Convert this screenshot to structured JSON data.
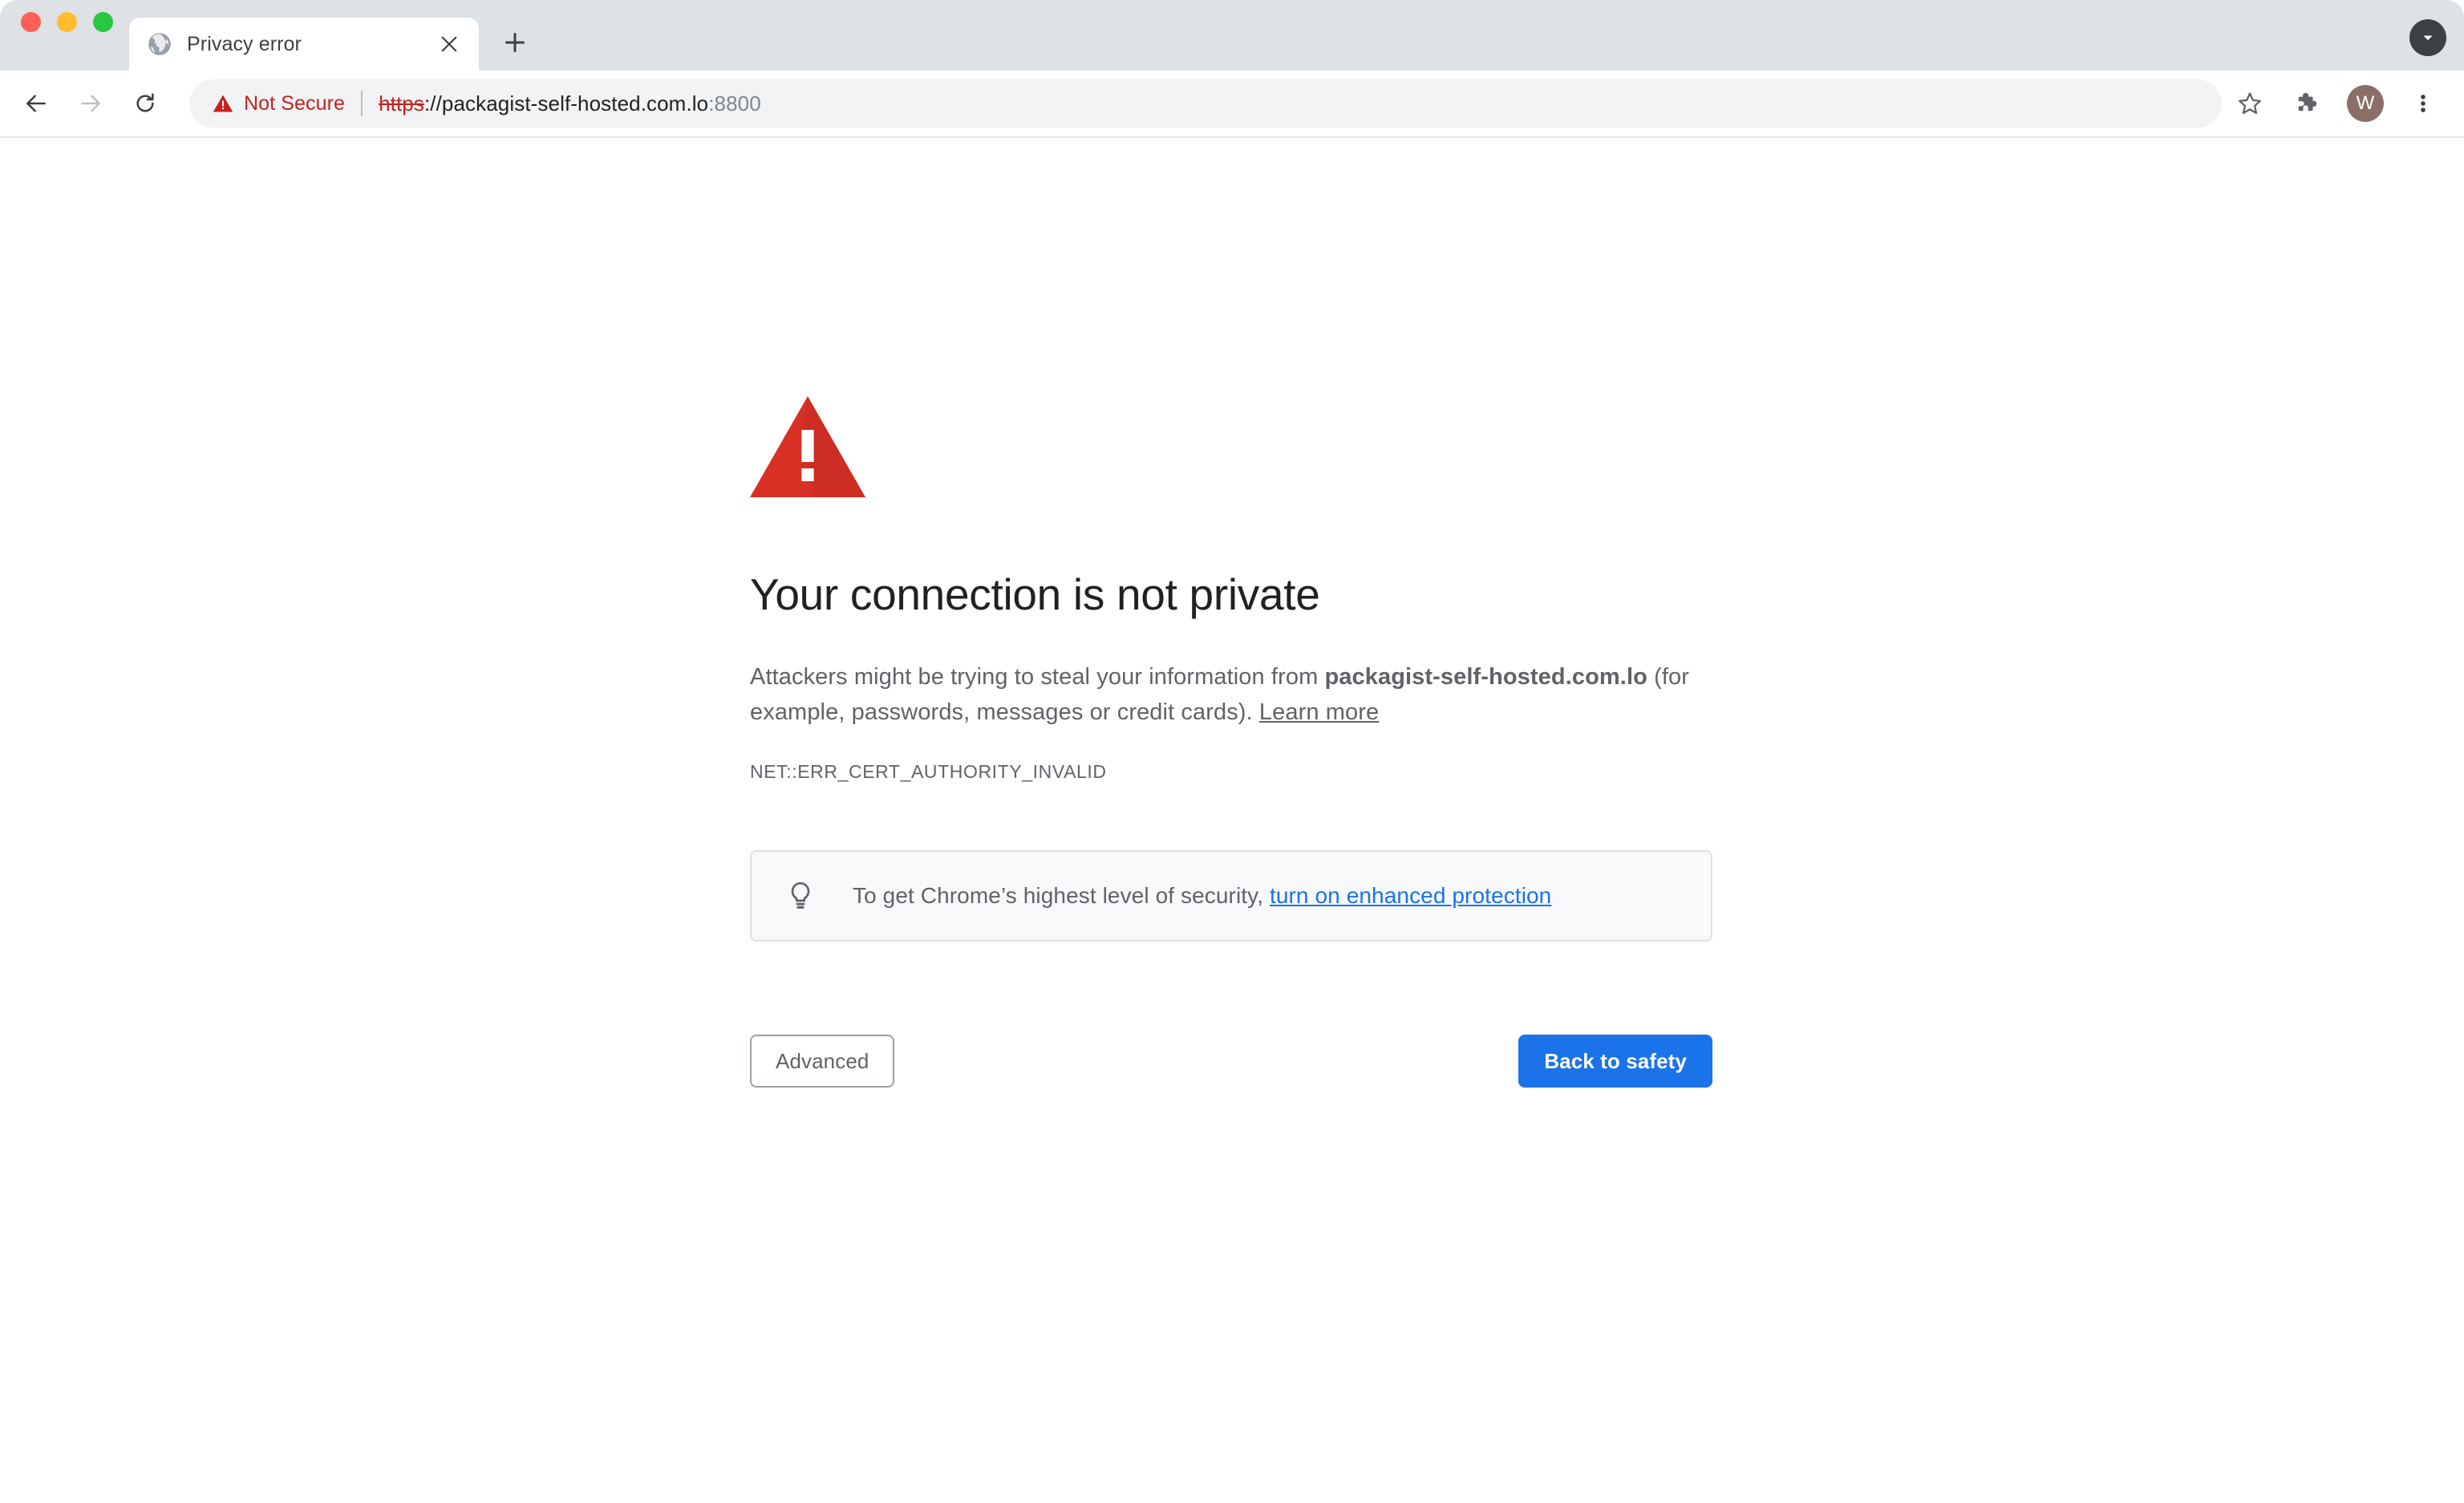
{
  "window": {
    "traffic_lights": [
      {
        "name": "close",
        "color": "#ff5f57"
      },
      {
        "name": "minimize",
        "color": "#febc2e"
      },
      {
        "name": "maximize",
        "color": "#28c840"
      }
    ]
  },
  "tab_strip": {
    "tabs": [
      {
        "title": "Privacy error",
        "favicon": "globe-icon",
        "active": true
      }
    ],
    "new_tab_label": "+",
    "tab_search_icon": "chevron-down-icon"
  },
  "toolbar": {
    "back_icon": "back-arrow-icon",
    "forward_icon": "forward-arrow-icon",
    "reload_icon": "reload-icon",
    "security_chip": {
      "icon": "warning-triangle-icon",
      "label": "Not Secure",
      "color": "#c5221f"
    },
    "url": {
      "scheme": "https",
      "separator": "://",
      "host": "packagist-self-hosted.com.lo",
      "port": ":8800",
      "full": "https://packagist-self-hosted.com.lo:8800"
    },
    "star_icon": "star-icon",
    "extensions_icon": "puzzle-piece-icon",
    "avatar_initial": "W",
    "avatar_color": "#8b6f66",
    "menu_icon": "three-dot-menu-icon"
  },
  "interstitial": {
    "icon": "red-warning-triangle-icon",
    "icon_color": "#d93025",
    "heading": "Your connection is not private",
    "body_prefix": "Attackers might be trying to steal your information from ",
    "body_domain": "packagist-self-hosted.com.lo",
    "body_suffix": " (for example, passwords, messages or credit cards). ",
    "learn_more_label": "Learn more",
    "error_code": "NET::ERR_CERT_AUTHORITY_INVALID",
    "protection_notice": {
      "icon": "lightbulb-icon",
      "text": "To get Chrome’s highest level of security, ",
      "link_label": "turn on enhanced protection",
      "link_color": "#1a73e8"
    },
    "advanced_button_label": "Advanced",
    "back_to_safety_button_label": "Back to safety",
    "primary_button_color": "#1a73e8"
  }
}
